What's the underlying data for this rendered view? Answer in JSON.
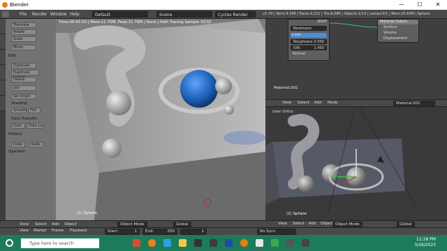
{
  "window": {
    "title": "Blender",
    "min": "—",
    "max": "☐",
    "close": "✕"
  },
  "infobar": {
    "menus": [
      "File",
      "Render",
      "Window",
      "Help"
    ],
    "screen_layout": "Default",
    "scene": "Scene",
    "render_engine": "Cycles Render",
    "stats": "v2.79 | Verts:4,348 | Faces:4,221 | Tris:8,586 | Objects:1/13 | Lamps:0/1 | Mem:25.63M | Sphere"
  },
  "sidebar_tabs": [
    "Tools",
    "Create",
    "Relations",
    "Animation",
    "Physics",
    "Grease Pencil"
  ],
  "toolpanel": {
    "buttons_transform": [
      "Translate",
      "Rotate",
      "Scale"
    ],
    "mirror": "Mirror",
    "edit_header": "Edit",
    "edit_buttons": [
      "Duplicate",
      "Duplicate Linked",
      "Delete",
      "Join"
    ],
    "set_origin": "Set Origin",
    "shading_label": "Shading:",
    "smooth": "Smooth",
    "flat": "Flat",
    "data_transfer_label": "Data Transfer:",
    "data": "Data",
    "data_la": "Data La",
    "history_header": "History",
    "undo": "Undo",
    "redo": "Redo",
    "operator_header": "Operator"
  },
  "viewport": {
    "render_info": "Time:00:43.50 | Mem:11.75M, Peak:11.76M | Done | Path Tracing Sample 32/32",
    "object_label": "(1) Sphere",
    "menus": [
      "View",
      "Select",
      "Add",
      "Object"
    ],
    "mode": "Object Mode",
    "pivot": "Global"
  },
  "node_editor": {
    "bsdf_title": "BSDF",
    "beckmann": "Beckmann",
    "color_label": "Color",
    "roughness": "Roughness:",
    "roughness_val": "0.000",
    "ior": "IOR:",
    "ior_val": "1.450",
    "normal": "Normal",
    "output_title": "Material Output",
    "output_sockets": [
      "Surface",
      "Volume",
      "Displacement"
    ],
    "material_name": "Material.001",
    "menus": [
      "View",
      "Select",
      "Add",
      "Node"
    ],
    "material_field": "Material.001"
  },
  "view2": {
    "label": "User Ortho",
    "object_label": "(1) Sphere",
    "menus": [
      "View",
      "Select",
      "Add",
      "Object"
    ],
    "mode": "Object Mode",
    "pivot": "Global"
  },
  "timeline": {
    "menus": [
      "View",
      "Marker",
      "Frame",
      "Playback"
    ],
    "start": "Start:",
    "start_val": "1",
    "end": "End:",
    "end_val": "250",
    "current": "1",
    "sync": "No Sync"
  },
  "taskbar": {
    "search_placeholder": "Type here to search",
    "time": "11:28 PM",
    "date": "3/26/2023"
  },
  "colors": {
    "taskbar": "#1e7b5a",
    "blender_orange": "#e87d0d",
    "sphere_blue": "#1e63b8"
  }
}
